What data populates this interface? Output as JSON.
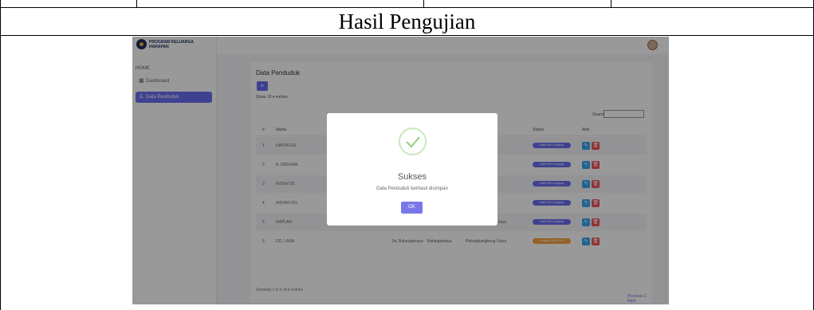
{
  "document": {
    "caption": "Hasil Pengujian"
  },
  "app": {
    "brand": "PROGRAM KELUARGA HARAPAN",
    "menu_head": "HOME",
    "menu": [
      {
        "label": "Dashboard",
        "icon": "grid-icon"
      },
      {
        "label": "Data Penduduk",
        "icon": "user-icon"
      }
    ]
  },
  "page": {
    "title": "Data Penduduk",
    "add_label": "+",
    "show_entries": "Show 10 ▾ entries",
    "search_label": "Search:",
    "columns": [
      "#",
      "Nama",
      "",
      "",
      "",
      "Status",
      "Aksi"
    ],
    "rows": [
      {
        "no": "1",
        "nama": "DARYA DG",
        "c3": "",
        "c4": "",
        "c5": "gkeng Utara",
        "status": "Data PKH Lengkap",
        "status_color": "#6a6ff0"
      },
      {
        "no": "2",
        "nama": "A. DERGAN",
        "c3": "",
        "c4": "",
        "c5": "gkeng Utara",
        "status": "Data PKH Lengkap",
        "status_color": "#6a6ff0"
      },
      {
        "no": "3",
        "nama": "RISKA DG",
        "c3": "",
        "c4": "",
        "c5": "gkeng Utara",
        "status": "Data PKH Lengkap",
        "status_color": "#6a6ff0"
      },
      {
        "no": "4",
        "nama": "AISYAH DG",
        "c3": "",
        "c4": "",
        "c5": "gkeng Utara",
        "status": "Data PKH Lengkap",
        "status_color": "#6a6ff0"
      },
      {
        "no": "5",
        "nama": "RAPLAH",
        "c3": "Balangtanaya",
        "c4": "Balangtanaya",
        "c5": "Polongbangkeng Utara",
        "status": "Data PKH Lengkap",
        "status_color": "#6a6ff0"
      },
      {
        "no": "6",
        "nama": "DG. LANA",
        "c3": "Jln. Balangtanaya",
        "c4": "Balangtanaya",
        "c5": "Polongbangkeng Utara",
        "status": "Lengkapi Data PKH",
        "status_color": "#f7a23c"
      }
    ],
    "showing": "Showing 1 to 6 of 6 entries",
    "pager": "Previous 1 Next"
  },
  "modal": {
    "title": "Sukses",
    "message": "Data Penduduk berhasil disimpan",
    "ok_label": "OK",
    "icon": "check-icon"
  }
}
